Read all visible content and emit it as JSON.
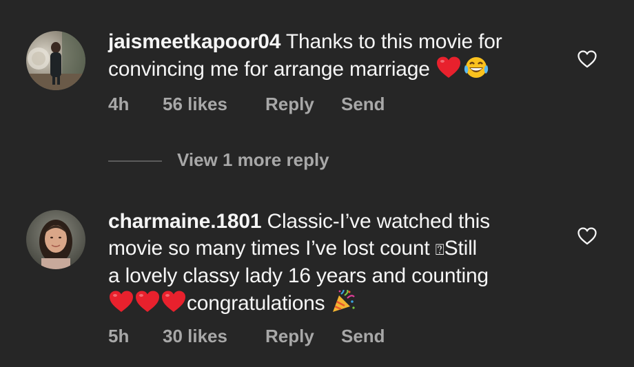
{
  "comments": [
    {
      "username": "jaismeetkapoor04",
      "text_parts": [
        " Thanks to this movie for convincing me for arrange marriage "
      ],
      "emojis": [
        "red-heart",
        "tears-of-joy"
      ],
      "time": "4h",
      "likes": "56 likes",
      "reply_label": "Reply",
      "send_label": "Send"
    },
    {
      "username": "charmaine.1801",
      "text_line1": " Classic-I’ve watched this",
      "text_line2": "movie so many times I’ve lost count ",
      "missing_glyph": "⍰",
      "text_line2b": "Still",
      "text_line3": "a lovely classy lady 16 years and counting",
      "text_line4": "congratulations ",
      "emojis": [
        "red-heart",
        "red-heart",
        "red-heart",
        "party-popper"
      ],
      "time": "5h",
      "likes": "30 likes",
      "reply_label": "Reply",
      "send_label": "Send"
    }
  ],
  "view_more": {
    "label": "View 1 more reply"
  },
  "colors": {
    "background": "#262626",
    "primary_text": "#f5f5f5",
    "secondary_text": "#a8a8a8",
    "heart_red": "#e8212d"
  },
  "icons": {
    "like": "heart-outline-icon",
    "avatar1": "avatar-photo",
    "avatar2": "avatar-photo"
  }
}
